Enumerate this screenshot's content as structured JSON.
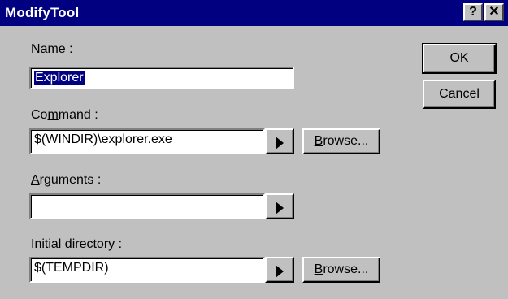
{
  "window": {
    "title": "ModifyTool",
    "help_glyph": "?",
    "close_glyph": "✕"
  },
  "form": {
    "name_label_prefix": "N",
    "name_label_rest": "ame :",
    "name_value": "Explorer",
    "command_label_prefix": "Co",
    "command_label_accel": "m",
    "command_label_rest": "mand :",
    "command_value": "$(WINDIR)\\explorer.exe",
    "arguments_label_prefix": "A",
    "arguments_label_rest": "rguments :",
    "arguments_value": "",
    "initdir_label_prefix": "I",
    "initdir_label_rest": "nitial directory :",
    "initdir_value": "$(TEMPDIR)"
  },
  "buttons": {
    "ok": "OK",
    "cancel": "Cancel",
    "browse_prefix": "B",
    "browse_rest": "rowse..."
  }
}
